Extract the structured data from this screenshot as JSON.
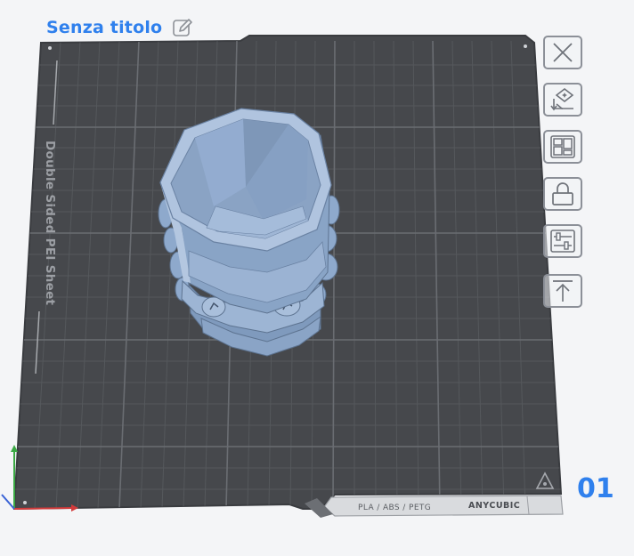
{
  "plate": {
    "title": "Senza titolo",
    "number": "01",
    "sheet_label": "Double Sided PEI Sheet",
    "material_label": "PLA / ABS / PETG",
    "brand_label": "ANYCUBIC"
  },
  "toolbar": {
    "buttons": [
      {
        "name": "close-plate-button",
        "icon": "close-icon"
      },
      {
        "name": "auto-orient-button",
        "icon": "auto-orient-icon"
      },
      {
        "name": "arrange-button",
        "icon": "arrange-icon"
      },
      {
        "name": "lock-plate-button",
        "icon": "lock-icon"
      },
      {
        "name": "plate-settings-button",
        "icon": "sliders-icon"
      },
      {
        "name": "move-to-top-button",
        "icon": "move-to-top-icon"
      }
    ]
  },
  "colors": {
    "accent": "#2f80ed",
    "bed": "#46484c",
    "grid": "#5c5f63",
    "model": "#8ea9cc"
  }
}
